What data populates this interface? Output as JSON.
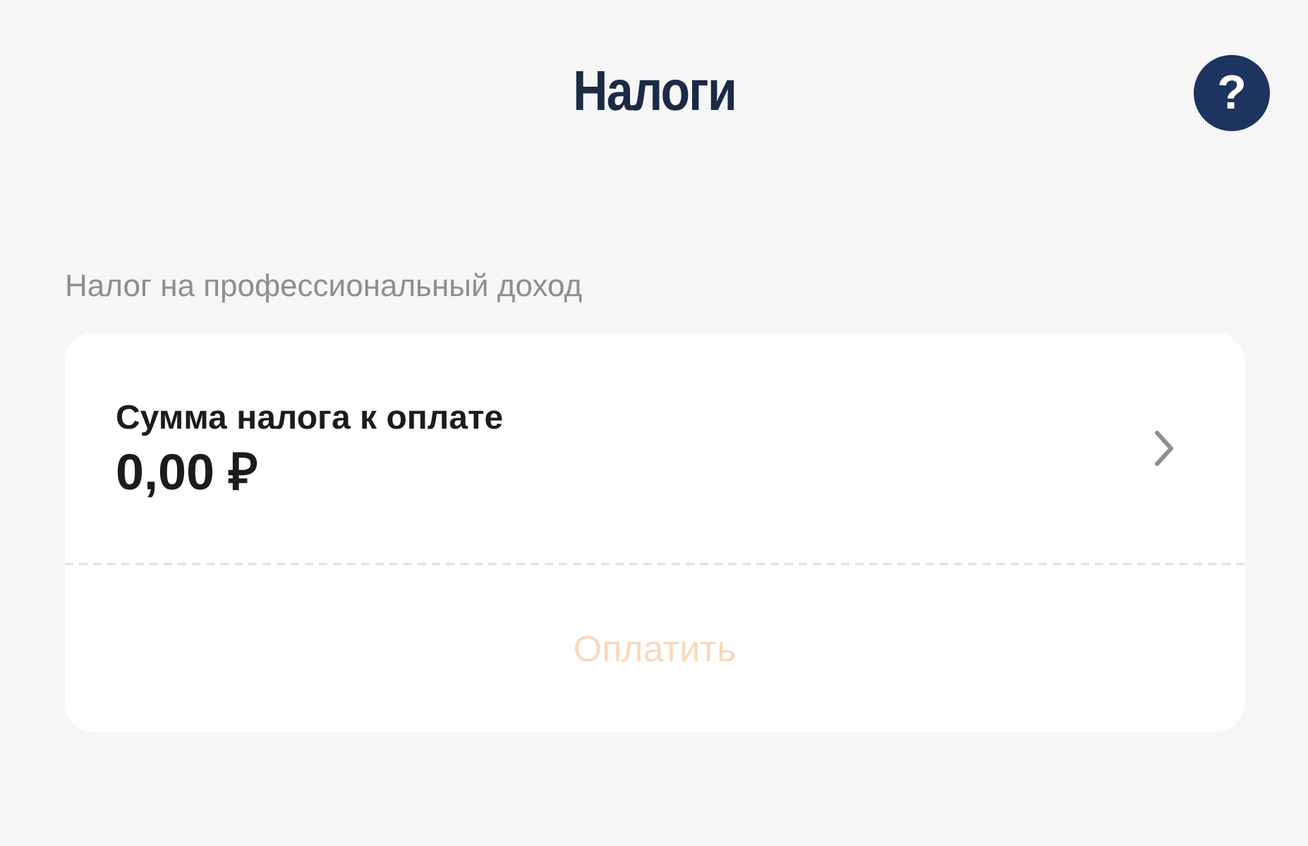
{
  "header": {
    "title": "Налоги",
    "help_button": "?"
  },
  "section": {
    "label": "Налог на профессиональный доход"
  },
  "card": {
    "caption": "Сумма налога к оплате",
    "amount": "0,00 ₽",
    "pay_button": {
      "label": "Оплатить",
      "disabled": true
    }
  }
}
